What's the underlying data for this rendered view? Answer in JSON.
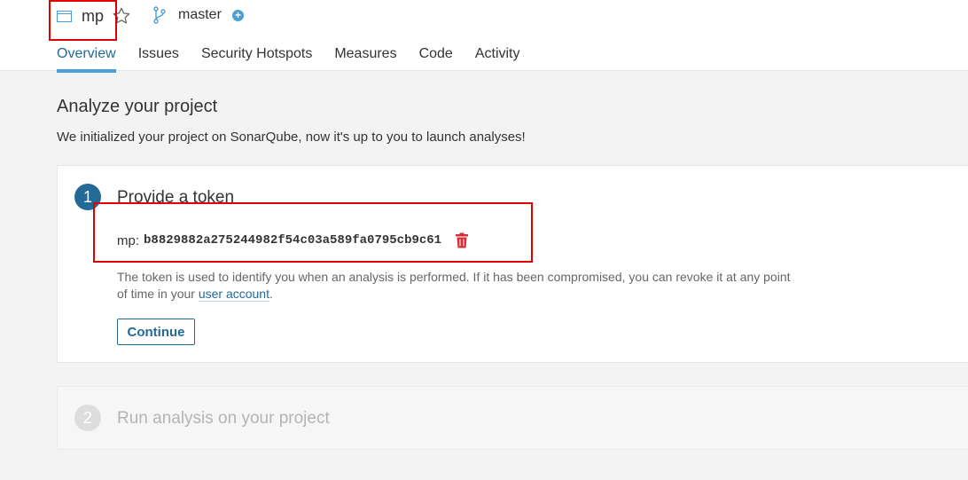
{
  "header": {
    "project_name": "mp",
    "branch_name": "master",
    "icons": {
      "project": "project-window-icon",
      "favorite": "star-icon",
      "branch": "branch-icon",
      "add": "plus-circle-icon"
    }
  },
  "tabs": [
    {
      "label": "Overview",
      "active": true
    },
    {
      "label": "Issues"
    },
    {
      "label": "Security Hotspots"
    },
    {
      "label": "Measures"
    },
    {
      "label": "Code"
    },
    {
      "label": "Activity"
    }
  ],
  "main": {
    "title": "Analyze your project",
    "subtitle": "We initialized your project on SonarQube, now it's up to you to launch analyses!"
  },
  "step1": {
    "number": "1",
    "title": "Provide a token",
    "token_label": "mp:",
    "token_value": "b8829882a275244982f54c03a589fa0795cb9c61",
    "help_text": "The token is used to identify you when an analysis is performed. If it has been compromised, you can revoke it at any point of time in your ",
    "help_link": "user account",
    "help_end": ".",
    "continue_label": "Continue",
    "delete_icon": "trash-icon"
  },
  "step2": {
    "number": "2",
    "title": "Run analysis on your project"
  },
  "colors": {
    "accent": "#236a97",
    "tab_underline": "#4b9fd5",
    "step_active": "#236a97",
    "step_inactive": "#dddddd",
    "delete": "#d02f3a",
    "annotation": "#e00000"
  }
}
